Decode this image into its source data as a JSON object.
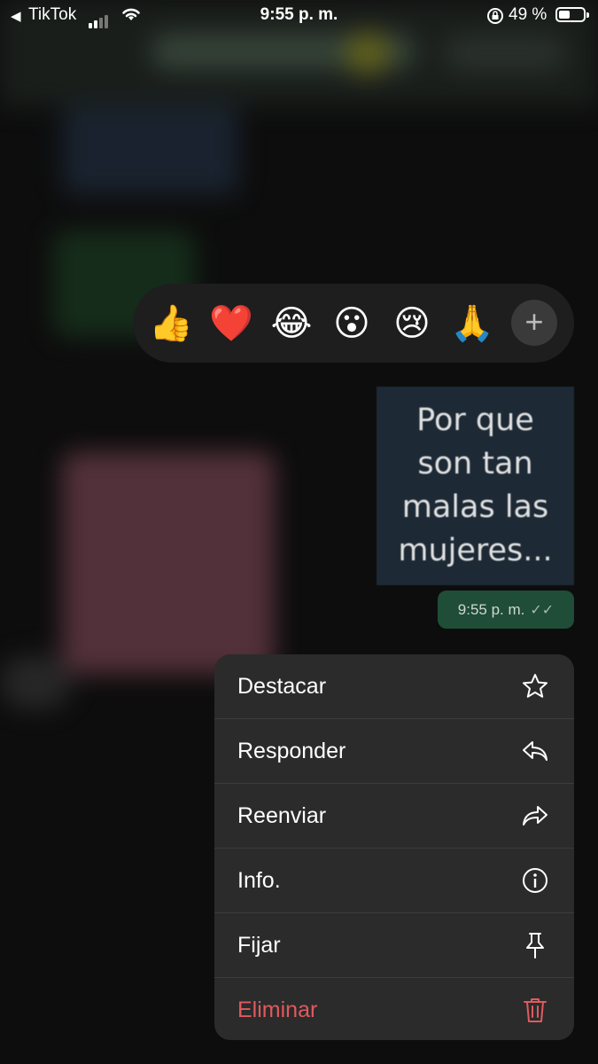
{
  "status_bar": {
    "back_app": "TikTok",
    "time": "9:55 p. m.",
    "battery": "49 %"
  },
  "reactions": [
    {
      "icon": "thumbs-up",
      "glyph": "👍"
    },
    {
      "icon": "red-heart",
      "glyph": "❤️"
    },
    {
      "icon": "tears-of-joy",
      "glyph": "😂"
    },
    {
      "icon": "surprised-face",
      "glyph": "😮"
    },
    {
      "icon": "crying-face",
      "glyph": "😢"
    },
    {
      "icon": "folded-hands",
      "glyph": "🙏"
    }
  ],
  "reaction_more": "+",
  "message": {
    "image_text": "Por que son tan malas las mujeres...",
    "time": "9:55 p. m.",
    "status": "read"
  },
  "menu": {
    "items": [
      {
        "label": "Destacar",
        "icon": "star-icon"
      },
      {
        "label": "Responder",
        "icon": "reply-icon"
      },
      {
        "label": "Reenviar",
        "icon": "forward-icon"
      },
      {
        "label": "Info.",
        "icon": "info-icon"
      },
      {
        "label": "Fijar",
        "icon": "pin-icon"
      },
      {
        "label": "Eliminar",
        "icon": "trash-icon"
      }
    ]
  },
  "colors": {
    "menu_bg": "#2b2b2b",
    "danger": "#e05a5e",
    "bubble_sent": "#1f4d37",
    "reaction_bar_bg": "#1e1e1e"
  }
}
